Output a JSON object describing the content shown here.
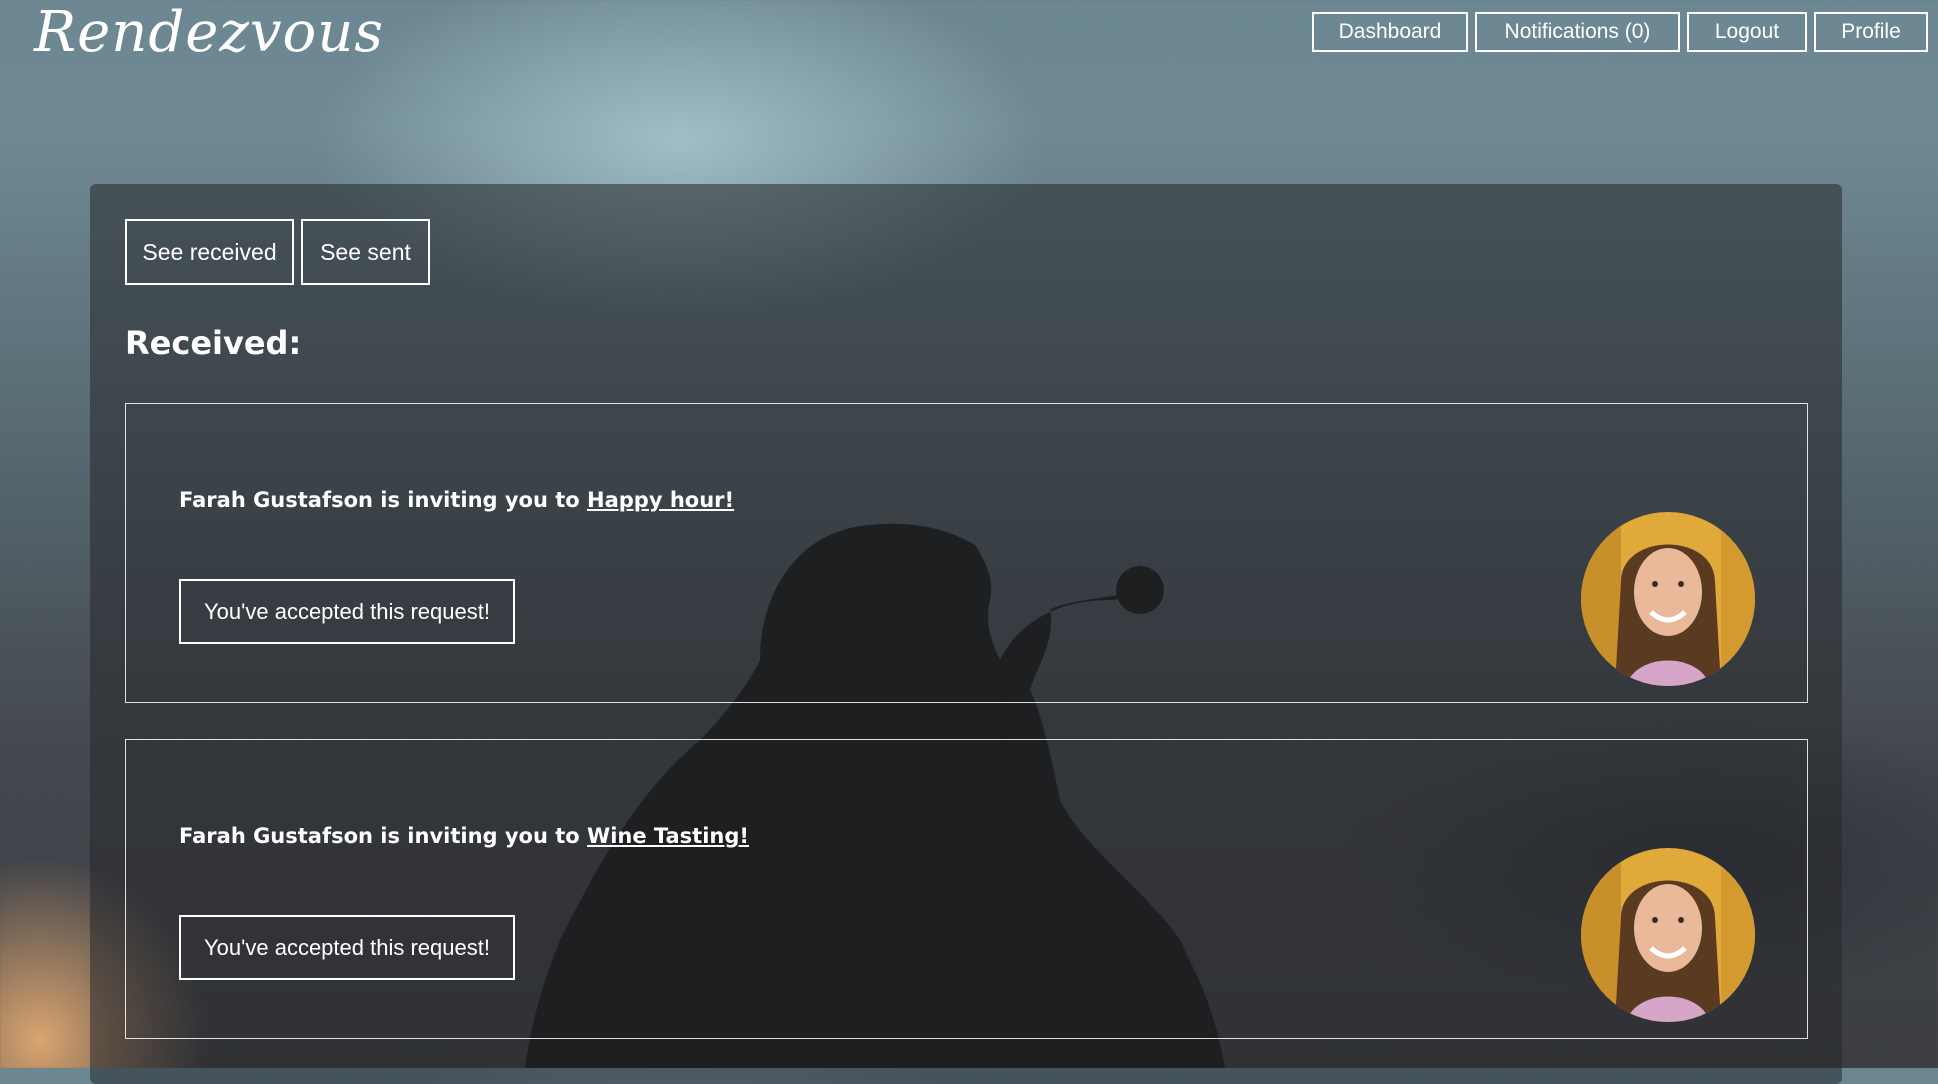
{
  "app": {
    "logo": "Rendezvous"
  },
  "nav": {
    "dashboard": "Dashboard",
    "notifications": "Notifications (0)",
    "logout": "Logout",
    "profile": "Profile"
  },
  "toggles": {
    "received": "See received",
    "sent": "See sent"
  },
  "section_title": "Received:",
  "requests": [
    {
      "sender": "Farah Gustafson",
      "invite_text": "is inviting you to",
      "event": "Happy hour!",
      "status": "You've accepted this request!"
    },
    {
      "sender": "Farah Gustafson",
      "invite_text": "is inviting you to",
      "event": "Wine Tasting!",
      "status": "You've accepted this request!"
    }
  ],
  "colors": {
    "text": "#ffffff",
    "panel": "#26282c",
    "avatar_background": "#e0a93a"
  }
}
